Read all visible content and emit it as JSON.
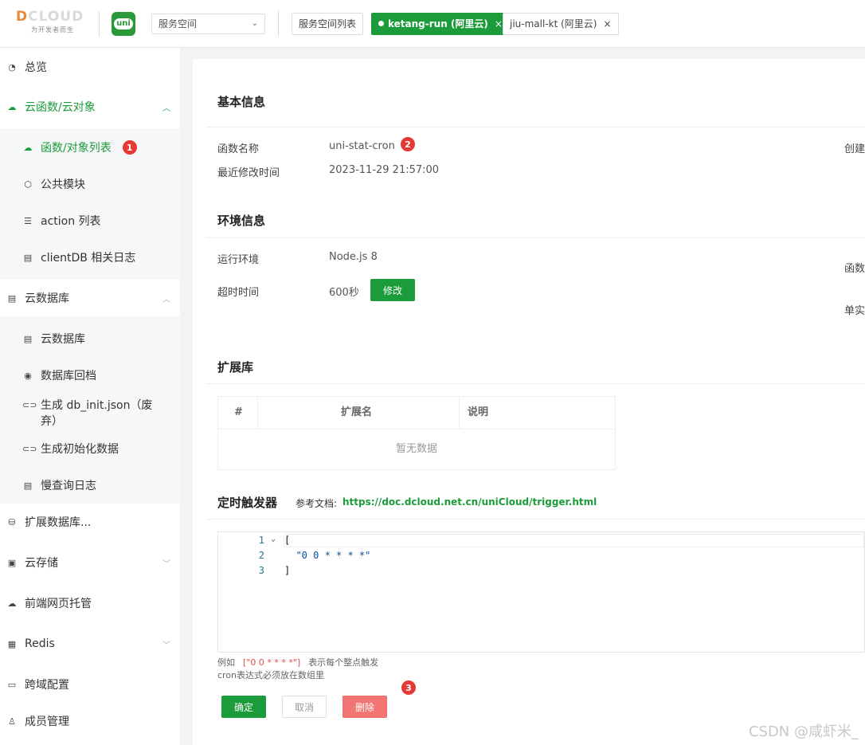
{
  "header": {
    "logo_brand": "DCLOUD",
    "logo_slogan": "为开发者而生",
    "uni_logo": "uni",
    "space_select": "服务空间",
    "tabs": [
      {
        "label": "服务空间列表"
      },
      {
        "label": "ketang-run (阿里云)",
        "close": "×"
      },
      {
        "label": "jiu-mall-kt (阿里云)",
        "close": "×"
      }
    ]
  },
  "sidebar": {
    "items": [
      {
        "label": "总览",
        "icon": "pie-chart-icon"
      },
      {
        "label": "云函数/云对象",
        "icon": "cloud-icon"
      },
      {
        "label": "函数/对象列表",
        "icon": "cloud-icon",
        "badge": "1"
      },
      {
        "label": "公共模块",
        "icon": "cube-icon"
      },
      {
        "label": "action 列表",
        "icon": "list-icon"
      },
      {
        "label": "clientDB 相关日志",
        "icon": "log-icon"
      },
      {
        "label": "云数据库",
        "icon": "table-icon"
      },
      {
        "label": "云数据库",
        "icon": "table-icon"
      },
      {
        "label": "数据库回档",
        "icon": "restore-icon"
      },
      {
        "label": "生成 db_init.json（废",
        "label2": "弃）",
        "icon": "link-icon"
      },
      {
        "label": "生成初始化数据",
        "icon": "link-icon"
      },
      {
        "label": "慢查询日志",
        "icon": "log-icon"
      },
      {
        "label": "扩展数据库...",
        "icon": "database-icon"
      },
      {
        "label": "云存储",
        "icon": "storage-icon"
      },
      {
        "label": "前端网页托管",
        "icon": "web-icon"
      },
      {
        "label": "Redis",
        "icon": "redis-icon"
      },
      {
        "label": "跨域配置",
        "icon": "cors-icon"
      },
      {
        "label": "成员管理",
        "icon": "user-icon"
      }
    ]
  },
  "basic": {
    "title": "基本信息",
    "func_name_label": "函数名称",
    "func_name_value": "uni-stat-cron",
    "func_badge": "2",
    "modified_label": "最近修改时间",
    "modified_value": "2023-11-29 21:57:00",
    "created_label_cut": "创建"
  },
  "env": {
    "title": "环境信息",
    "runtime_label": "运行环境",
    "runtime_value": "Node.js 8",
    "timeout_label": "超时时间",
    "timeout_value": "600秒",
    "edit_button": "修改",
    "right_cut_1": "函数",
    "right_cut_2": "单实"
  },
  "extensions": {
    "title": "扩展库",
    "columns": [
      "#",
      "扩展名",
      "说明"
    ],
    "empty_text": "暂无数据"
  },
  "trigger": {
    "title": "定时触发器",
    "ref_label": "参考文档:",
    "ref_link": "https://doc.dcloud.net.cn/uniCloud/trigger.html",
    "code_lines": [
      {
        "num": "1",
        "text": "["
      },
      {
        "num": "2",
        "text": "  \"0 0 * * * *\""
      },
      {
        "num": "3",
        "text": "]"
      }
    ],
    "hint_prefix": "例如",
    "hint_example": "[\"0 0 * * * *\"]",
    "hint_desc": "表示每个整点触发",
    "hint_line2": "cron表达式必须放在数组里",
    "badge": "3",
    "confirm_button": "确定",
    "cancel_button": "取消",
    "delete_button": "删除"
  },
  "watermark": "CSDN @咸虾米_"
}
